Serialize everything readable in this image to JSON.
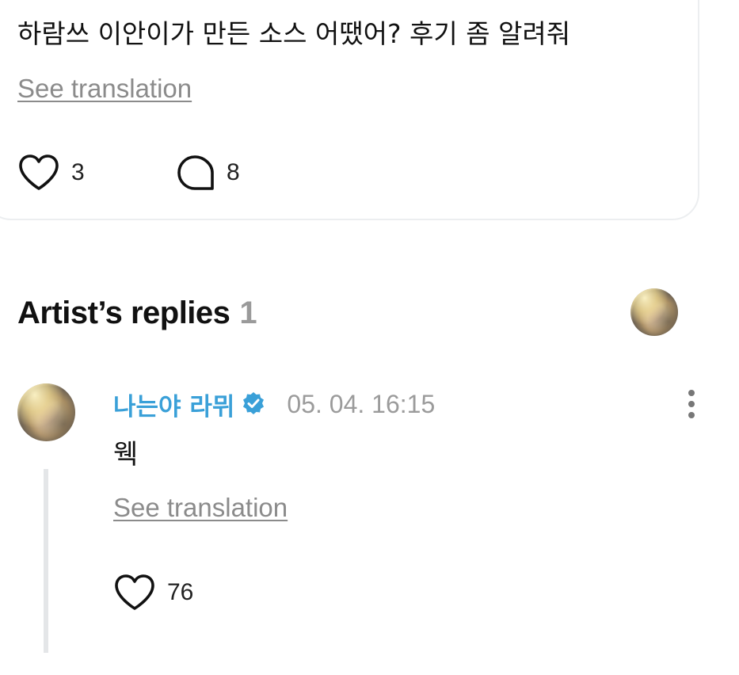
{
  "post": {
    "text": "하람쓰 이안이가 만든 소스 어땠어? 후기 좀 알려줘",
    "see_translation": "See translation",
    "likes": "3",
    "comments": "8"
  },
  "artist_replies": {
    "title": "Artist’s replies",
    "count": "1"
  },
  "reply": {
    "author": "나는야 라뮈",
    "date": "05. 04. 16:15",
    "text": "웩",
    "see_translation": "See translation",
    "likes": "76"
  },
  "colors": {
    "author": "#3aa0d8",
    "verified_badge": "#3aa0d8",
    "muted": "#8b8b8b",
    "thread_line": "#e4e6e8"
  },
  "icons": {
    "like": "heart-icon",
    "comment": "speech-bubble-icon",
    "verified": "verified-badge-icon",
    "more": "more-vertical-icon"
  }
}
